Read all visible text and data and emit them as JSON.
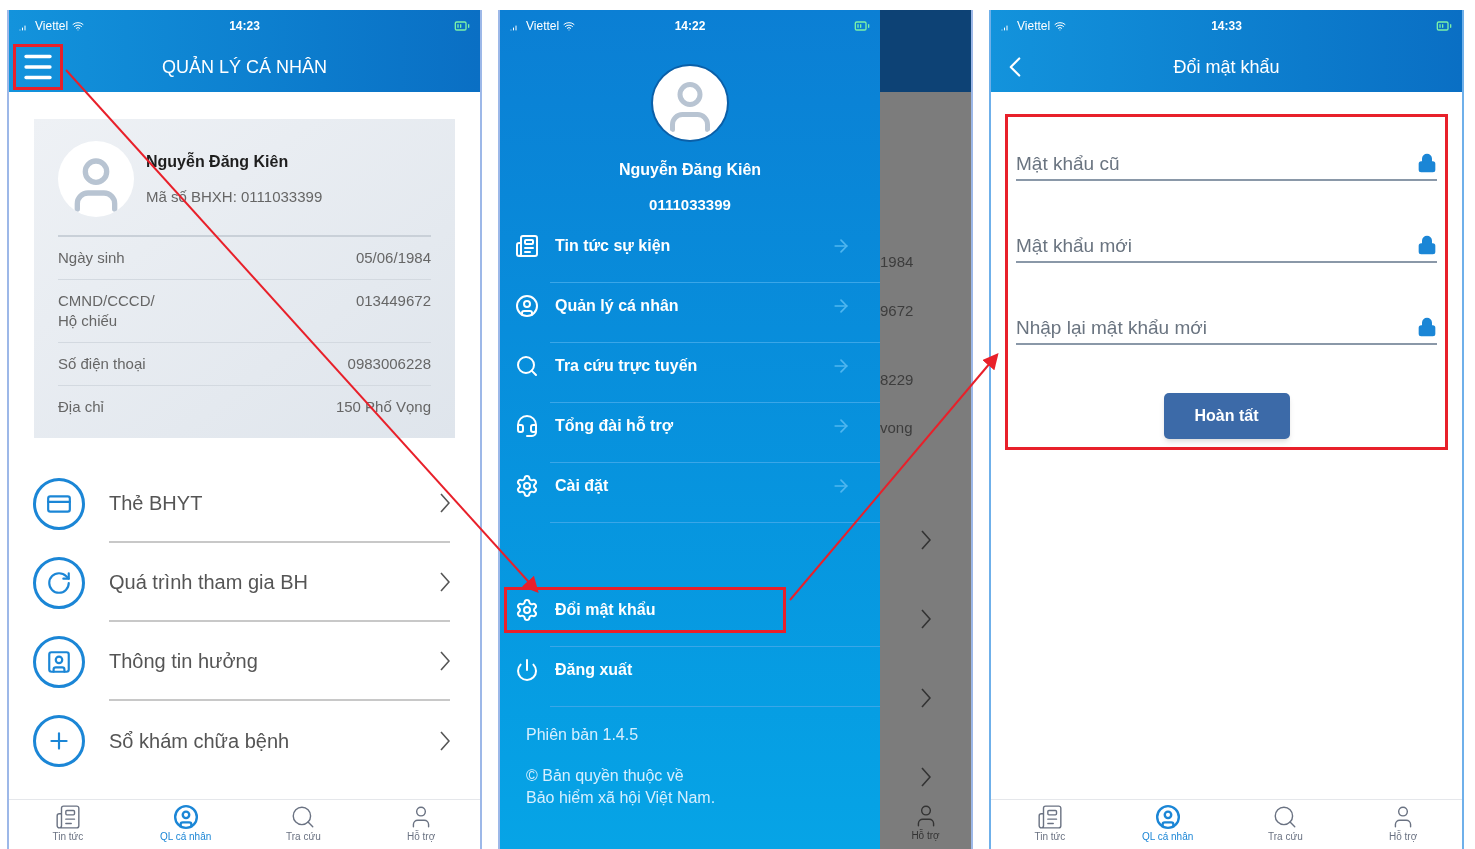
{
  "screens": [
    {
      "kind": "profile",
      "status_bar": {
        "carrier": "Viettel",
        "time": "14:23"
      },
      "header": {
        "title": "QUẢN LÝ CÁ NHÂN",
        "menu_highlighted": true
      },
      "profile": {
        "name": "Nguyễn Đăng Kiên",
        "id_line": "Mã số BHXH: 0111033399",
        "rows": [
          {
            "label": "Ngày sinh",
            "value": "05/06/1984"
          },
          {
            "label": "CMND/CCCD/\nHộ chiếu",
            "value": "013449672"
          },
          {
            "label": "Số điện thoại",
            "value": "0983006228"
          },
          {
            "label": "Địa chỉ",
            "value": "150 Phố Vọng"
          }
        ]
      },
      "menu": [
        "Thẻ BHYT",
        "Quá trình tham gia BH",
        "Thông tin hưởng",
        "Sổ khám chữa bệnh"
      ],
      "tab_bar": [
        {
          "label": "Tin tức",
          "selected": false
        },
        {
          "label": "QL cá nhân",
          "selected": true
        },
        {
          "label": "Tra cứu",
          "selected": false
        },
        {
          "label": "Hỗ trợ",
          "selected": false
        }
      ]
    },
    {
      "kind": "drawer",
      "status_bar": {
        "carrier": "Viettel",
        "time": "14:22"
      },
      "drawer": {
        "name": "Nguyễn Đăng Kiên",
        "id": "0111033399",
        "items": [
          {
            "label": "Tin tức sự kiện",
            "kind": "nav",
            "highlighted": false
          },
          {
            "label": "Quản lý cá nhân",
            "kind": "nav",
            "highlighted": false
          },
          {
            "label": "Tra cứu trực tuyến",
            "kind": "nav",
            "highlighted": false
          },
          {
            "label": "Tổng đài hỗ trợ",
            "kind": "nav",
            "highlighted": false
          },
          {
            "label": "Cài đặt",
            "kind": "nav",
            "highlighted": false
          },
          {
            "label": "Đổi mật khẩu",
            "kind": "action",
            "highlighted": true
          },
          {
            "label": "Đăng xuất",
            "kind": "action",
            "highlighted": false
          }
        ],
        "version": "Phiên bản 1.4.5",
        "copyright": [
          "© Bản quyền thuộc về",
          "Bảo hiểm xã hội Việt Nam."
        ]
      },
      "background": {
        "values": [
          "1984",
          "9672",
          "8229",
          "vong"
        ],
        "tab_label": "Hỗ trợ"
      }
    },
    {
      "kind": "change_password",
      "status_bar": {
        "carrier": "Viettel",
        "time": "14:33"
      },
      "header": {
        "title": "Đổi mật khẩu"
      },
      "form": {
        "highlighted": true,
        "fields": [
          {
            "placeholder": "Mật khẩu cũ"
          },
          {
            "placeholder": "Mật khẩu mới"
          },
          {
            "placeholder": "Nhập lại mật khẩu mới"
          }
        ],
        "button": "Hoàn tất"
      },
      "tab_bar": [
        {
          "label": "Tin tức",
          "selected": false
        },
        {
          "label": "QL cá nhân",
          "selected": true
        },
        {
          "label": "Tra cứu",
          "selected": false
        },
        {
          "label": "Hỗ trợ",
          "selected": false
        }
      ]
    }
  ]
}
